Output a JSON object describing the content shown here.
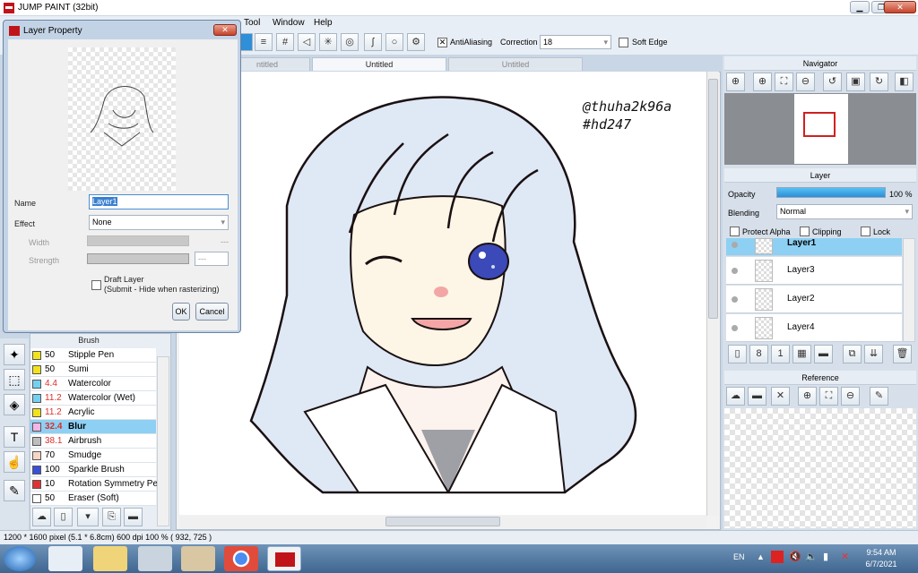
{
  "window": {
    "title": "JUMP PAINT (32bit)"
  },
  "menu": [
    "Tool",
    "Window",
    "Help"
  ],
  "toolbar": {
    "antialiasing": "AntiAliasing",
    "correction_label": "Correction",
    "correction_value": "18",
    "soft_edge": "Soft Edge"
  },
  "tabs": [
    "ntitled",
    "Untitled",
    "Untitled"
  ],
  "dialog": {
    "title": "Layer Property",
    "name_label": "Name",
    "name_value": "Layer1",
    "effect_label": "Effect",
    "effect_value": "None",
    "width_label": "Width",
    "strength_label": "Strength",
    "width_dash": "---",
    "strength_dash": "---",
    "draft_layer": "Draft Layer",
    "draft_note": "(Submit - Hide when rasterizing)",
    "ok": "OK",
    "cancel": "Cancel"
  },
  "brush": {
    "title": "Brush",
    "items": [
      {
        "value": "50",
        "name": "Stipple Pen",
        "color": "#f2e21b",
        "value_color": "#000"
      },
      {
        "value": "50",
        "name": "Sumi",
        "color": "#f2e21b",
        "value_color": "#000"
      },
      {
        "value": "4.4",
        "name": "Watercolor",
        "color": "#74d0f0",
        "value_color": "#d9302c"
      },
      {
        "value": "11.2",
        "name": "Watercolor (Wet)",
        "color": "#74d0f0",
        "value_color": "#d9302c"
      },
      {
        "value": "11.2",
        "name": "Acrylic",
        "color": "#f2e21b",
        "value_color": "#d9302c"
      },
      {
        "value": "32.4",
        "name": "Blur",
        "color": "#f5b4e4",
        "value_color": "#d9302c"
      },
      {
        "value": "38.1",
        "name": "Airbrush",
        "color": "#bdbdbd",
        "value_color": "#d9302c"
      },
      {
        "value": "70",
        "name": "Smudge",
        "color": "#f7d6c6",
        "value_color": "#000"
      },
      {
        "value": "100",
        "name": "Sparkle Brush",
        "color": "#3a4fd6",
        "value_color": "#000"
      },
      {
        "value": "10",
        "name": "Rotation Symmetry Pe",
        "color": "#e03232",
        "value_color": "#000"
      },
      {
        "value": "50",
        "name": "Eraser (Soft)",
        "color": "#ffffff",
        "value_color": "#000"
      }
    ]
  },
  "canvas": {
    "watermark1": "@thuha2k96a",
    "watermark2": "#hd247"
  },
  "navigator": {
    "title": "Navigator"
  },
  "layer": {
    "title": "Layer",
    "opacity_label": "Opacity",
    "opacity_value": "100 %",
    "opacity_fraction": 1.0,
    "blending_label": "Blending",
    "blending_value": "Normal",
    "protect_alpha": "Protect Alpha",
    "clipping": "Clipping",
    "lock": "Lock",
    "layers": [
      "Layer1",
      "Layer3",
      "Layer2",
      "Layer4"
    ]
  },
  "reference": {
    "title": "Reference"
  },
  "status": {
    "text": "1200 * 1600 pixel   (5.1 * 6.8cm)   600 dpi   100 %   ( 932, 725 )"
  },
  "taskbar": {
    "lang": "EN",
    "time": "9:54 AM",
    "date": "6/7/2021"
  }
}
